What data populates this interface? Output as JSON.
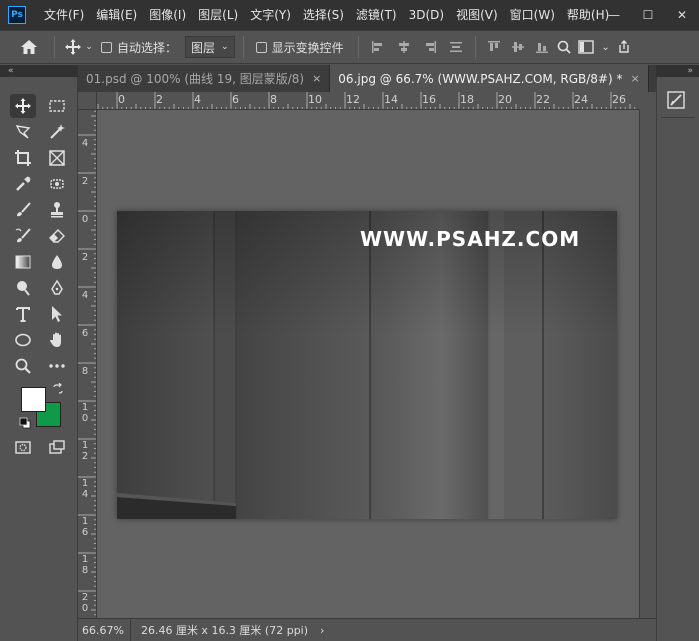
{
  "app": {
    "logo": "Ps"
  },
  "menu": [
    "文件(F)",
    "编辑(E)",
    "图像(I)",
    "图层(L)",
    "文字(Y)",
    "选择(S)",
    "滤镜(T)",
    "3D(D)",
    "视图(V)",
    "窗口(W)",
    "帮助(H)"
  ],
  "window_controls": {
    "minimize": "—",
    "maximize": "☐",
    "close": "✕"
  },
  "options": {
    "auto_select_label": "自动选择：",
    "auto_select_checked": false,
    "auto_select_target": "图层",
    "show_transform_label": "显示变换控件",
    "show_transform_checked": false
  },
  "panels": {
    "collapse_left": "«",
    "collapse_right": "»"
  },
  "tabs": [
    {
      "label": "01.psd @ 100% (曲线 19, 图层蒙版/8)",
      "close": "×",
      "active": false
    },
    {
      "label": "06.jpg @ 66.7% (WWW.PSAHZ.COM, RGB/8#) *",
      "close": "×",
      "active": true
    }
  ],
  "ruler_top": [
    "0",
    "2",
    "4",
    "6",
    "8",
    "10",
    "12",
    "14",
    "16",
    "18",
    "20",
    "22",
    "24",
    "26"
  ],
  "ruler_left": [
    "4",
    "2",
    "0",
    "2",
    "4",
    "6",
    "8",
    "1\n0",
    "1\n2",
    "1\n4",
    "1\n6",
    "1\n8",
    "2\n0"
  ],
  "canvas": {
    "watermark": "WWW.PSAHZ.COM",
    "colors": {
      "foreground": "#ffffff",
      "background": "#0f9a4a"
    }
  },
  "status": {
    "zoom": "66.67%",
    "doc_info": "26.46 厘米 x 16.3 厘米 (72 ppi)",
    "arrow": "›"
  },
  "icons": {
    "home": "home-icon",
    "move": "move-icon",
    "brush_settings": "adjustment-icon"
  }
}
